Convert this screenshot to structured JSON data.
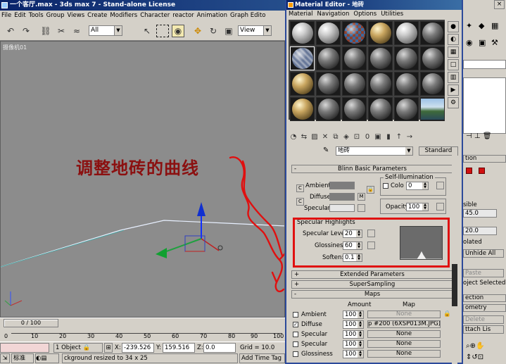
{
  "main_window": {
    "title": "一个客厅.max - 3ds max 7  - Stand-alone License",
    "menu": [
      "File",
      "Edit",
      "Tools",
      "Group",
      "Views",
      "Create",
      "Modifiers",
      "Character",
      "reactor",
      "Animation",
      "Graph Edito"
    ],
    "toolbar": {
      "filter_value": "All",
      "refcoord_value": "View"
    },
    "viewport_label": "摄像机01",
    "annotation": "调整地砖的曲线",
    "time_slider": "0 / 100",
    "track_ticks": [
      "0",
      "10",
      "20",
      "30",
      "40",
      "50",
      "60",
      "70",
      "80",
      "90",
      "100"
    ],
    "status": {
      "selection": "1 Object",
      "x_label": "X:",
      "x_value": "-239.526",
      "y_label": "Y:",
      "y_value": "159.516",
      "z_label": "Z:",
      "z_value": "0.0",
      "grid": "Grid = 10.0",
      "prompt_mode": "标准",
      "prompt_text": "ckground resized to 34 x 25",
      "add_time_tag": "Add Time Tag"
    }
  },
  "material_editor": {
    "title": "Material Editor - 地砖",
    "menu": [
      "Material",
      "Navigation",
      "Options",
      "Utilities"
    ],
    "material_name": "地砖",
    "material_type": "Standard",
    "rollouts": {
      "blinn": "Blinn Basic Parameters",
      "extended": "Extended Parameters",
      "supersampling": "SuperSampling",
      "maps": "Maps"
    },
    "basic": {
      "ambient": "Ambient:",
      "diffuse": "Diffuse:",
      "specular": "Specular:",
      "self_illum_title": "Self-Illumination",
      "color_label": "Colo",
      "color_value": "0",
      "opacity_label": "Opacity:",
      "opacity_value": "100",
      "lock_m": "M"
    },
    "specular_highlights": {
      "title": "Specular Highlights",
      "level_label": "Specular Level:",
      "level_value": "20",
      "gloss_label": "Glossiness:",
      "gloss_value": "60",
      "soften_label": "Soften:",
      "soften_value": "0.1"
    },
    "maps": {
      "amount_header": "Amount",
      "map_header": "Map",
      "rows": [
        {
          "name": "Ambient",
          "checked": false,
          "amount": "100",
          "map": "None"
        },
        {
          "name": "Diffuse",
          "checked": true,
          "amount": "100",
          "map": "p #200 (6XSP013M.JPG)"
        },
        {
          "name": "Specular",
          "checked": false,
          "amount": "100",
          "map": "None"
        },
        {
          "name": "Specular",
          "checked": false,
          "amount": "100",
          "map": "None"
        },
        {
          "name": "Glossiness",
          "checked": false,
          "amount": "100",
          "map": "None"
        }
      ]
    }
  },
  "command_panel": {
    "items": [
      {
        "text": "sible"
      },
      {
        "text": "45.0"
      },
      {
        "text": "20.0"
      },
      {
        "text": "olated"
      },
      {
        "text": "Unhide All"
      },
      {
        "text": "Paste"
      },
      {
        "text": "oject Selected"
      },
      {
        "text": "ection"
      },
      {
        "text": "ometry"
      },
      {
        "text": "Delete"
      },
      {
        "text": "ttach Lis"
      }
    ],
    "close_glyph": "×"
  },
  "colors": {
    "title_bar": "#0a246a",
    "viewport": "#8c8c8c",
    "annotation": "#8b1010",
    "highlight_box": "#e01010"
  }
}
